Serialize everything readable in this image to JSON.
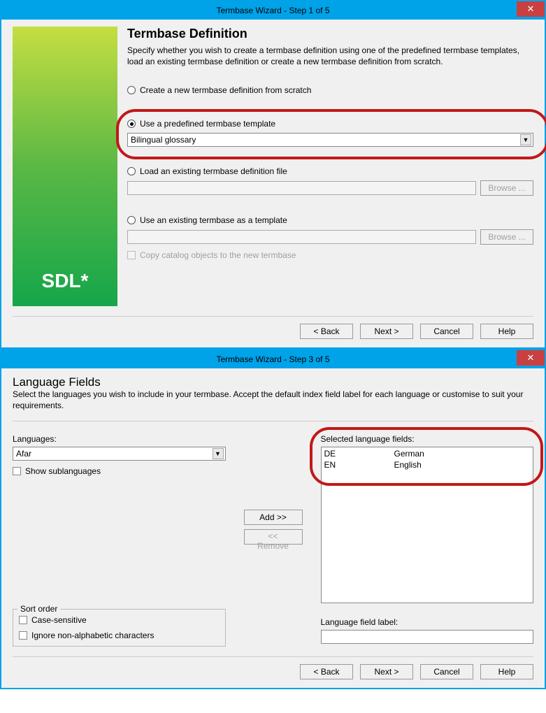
{
  "window1": {
    "title": "Termbase Wizard - Step 1 of 5",
    "logo": "SDL*",
    "heading": "Termbase Definition",
    "description": "Specify whether you wish to create a termbase definition using one of the predefined termbase templates, load an existing termbase definition or create a new termbase definition from scratch.",
    "options": {
      "scratch": "Create a new termbase definition from scratch",
      "predefined": "Use a predefined termbase template",
      "predefined_selected": "Bilingual glossary",
      "load_file": "Load an existing termbase definition file",
      "use_existing": "Use an existing termbase as a template",
      "copy_catalog": "Copy catalog objects to the new termbase",
      "browse": "Browse ..."
    },
    "buttons": {
      "back": "< Back",
      "next": "Next >",
      "cancel": "Cancel",
      "help": "Help"
    }
  },
  "window2": {
    "title": "Termbase Wizard - Step 3 of 5",
    "heading": "Language Fields",
    "description": "Select the languages you wish to include in your termbase. Accept the default index field label for each language or customise to suit your requirements.",
    "languages_label": "Languages:",
    "languages_selected": "Afar",
    "show_sublanguages": "Show sublanguages",
    "add": "Add >>",
    "remove": "<< Remove",
    "selected_label": "Selected language fields:",
    "selected": [
      {
        "code": "DE",
        "name": "German"
      },
      {
        "code": "EN",
        "name": "English"
      }
    ],
    "sort_order": {
      "legend": "Sort order",
      "case_sensitive": "Case-sensitive",
      "ignore_nonalpha": "Ignore non-alphabetic characters"
    },
    "field_label": "Language field label:",
    "buttons": {
      "back": "< Back",
      "next": "Next >",
      "cancel": "Cancel",
      "help": "Help"
    }
  }
}
